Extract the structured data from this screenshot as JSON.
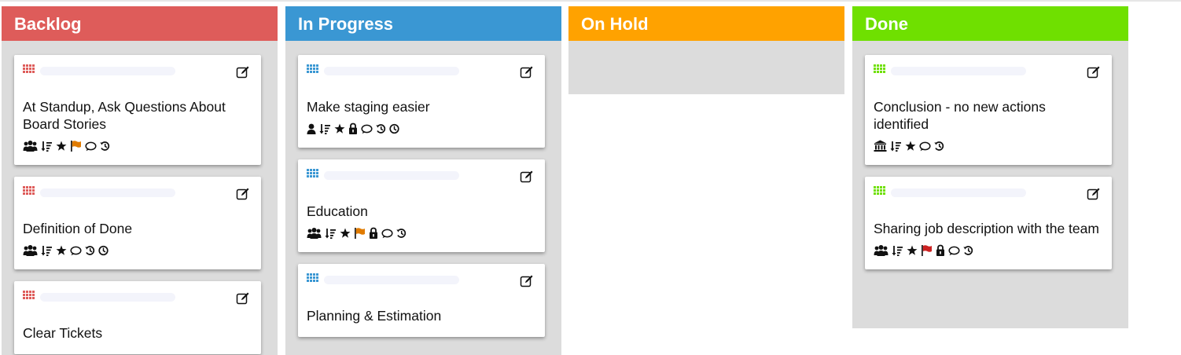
{
  "board": {
    "columns": [
      {
        "title": "Backlog",
        "color": "#de5c5a",
        "cards": [
          {
            "title": "At Standup, Ask Questions About Board Stories",
            "icons": [
              "team-icon",
              "sort-icon",
              "star-icon",
              "flag-icon",
              "comment-icon",
              "history-icon"
            ]
          },
          {
            "title": "Definition of Done",
            "icons": [
              "team-icon",
              "sort-icon",
              "star-icon",
              "comment-icon",
              "history-icon",
              "clock-icon"
            ]
          },
          {
            "title": "Clear Tickets",
            "icons": []
          }
        ]
      },
      {
        "title": "In Progress",
        "color": "#3a97d3",
        "cards": [
          {
            "title": "Make staging easier",
            "icons": [
              "user-icon",
              "sort-icon",
              "star-icon",
              "lock-icon",
              "comment-icon",
              "history-icon",
              "clock-icon"
            ]
          },
          {
            "title": "Education",
            "icons": [
              "team-icon",
              "sort-icon",
              "star-icon",
              "flag-icon",
              "lock-icon",
              "comment-icon",
              "history-icon"
            ]
          },
          {
            "title": "Planning & Estimation",
            "icons": []
          }
        ]
      },
      {
        "title": "On Hold",
        "color": "#ffa200",
        "cards": []
      },
      {
        "title": "Done",
        "color": "#6fe000",
        "cards": [
          {
            "title": "Conclusion - no new actions identified",
            "icons": [
              "bank-icon",
              "sort-icon",
              "star-icon",
              "comment-icon",
              "history-icon"
            ]
          },
          {
            "title": "Sharing job description with the team",
            "icons": [
              "team-icon",
              "sort-icon",
              "star-icon",
              "flag-icon",
              "lock-icon",
              "comment-icon",
              "history-icon"
            ]
          }
        ]
      }
    ]
  },
  "colors": {
    "flag_orange": "#e07b00",
    "flag_red": "#cc2222"
  }
}
